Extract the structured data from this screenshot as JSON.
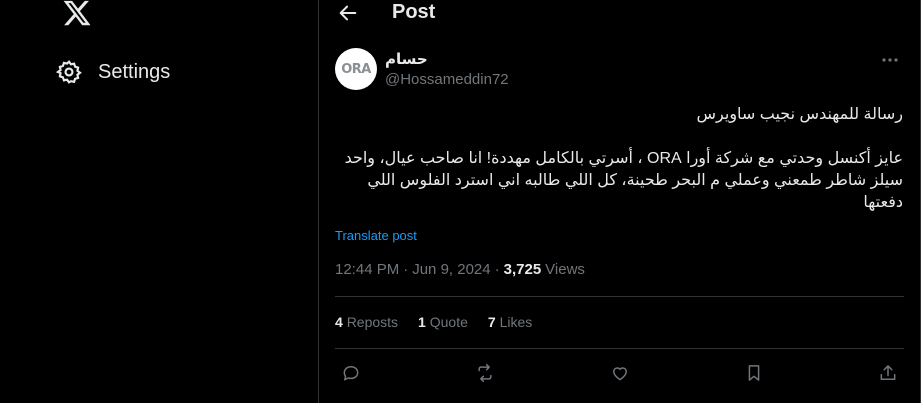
{
  "nav": {
    "logo_icon": "x-logo-icon",
    "settings_label": "Settings",
    "settings_icon": "gear-icon"
  },
  "topbar": {
    "title": "Post",
    "back_icon": "arrow-left-icon"
  },
  "post": {
    "avatar_text": "ORA",
    "display_name": "حسام",
    "handle": "@Hossameddin72",
    "body_line1": "رسالة للمهندس نجيب ساويرس",
    "body_para2": "عايز أكنسل وحدتي مع شركة أورا ORA ، أسرتي بالكامل مهددة! انا صاحب عيال، واحد سيلز شاطر طمعني وعملي م البحر طحينة، كل اللي طالبه اني استرد الفلوس اللي دفعتها",
    "translate_label": "Translate post",
    "time": "12:44 PM",
    "separator1": "·",
    "date": "Jun 9, 2024",
    "separator2": "·",
    "views_count": "3,725",
    "views_label": "Views"
  },
  "stats": {
    "reposts_count": "4",
    "reposts_label": "Reposts",
    "quotes_count": "1",
    "quotes_label": "Quote",
    "likes_count": "7",
    "likes_label": "Likes"
  },
  "actions": [
    "reply-icon",
    "repost-icon",
    "like-icon",
    "bookmark-icon",
    "share-icon"
  ],
  "colors": {
    "background": "#000000",
    "text": "#e7e9ea",
    "muted": "#71767b",
    "accent": "#1d9bf0",
    "border": "#2f3336"
  }
}
